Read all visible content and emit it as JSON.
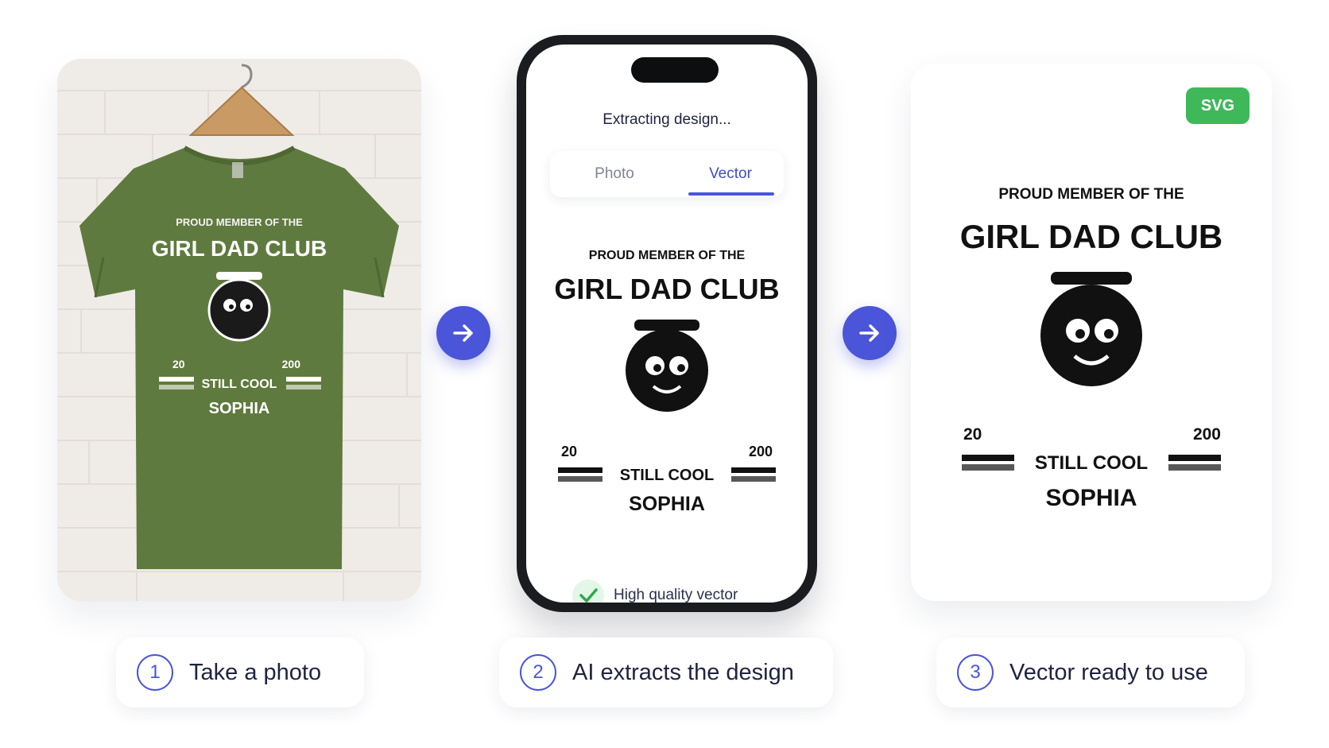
{
  "steps": [
    {
      "number": "1",
      "label": "Take a photo"
    },
    {
      "number": "2",
      "label": "AI extracts the design"
    },
    {
      "number": "3",
      "label": "Vector ready to use"
    }
  ],
  "phone": {
    "status": "Extracting design...",
    "tabs": [
      {
        "label": "Photo"
      },
      {
        "label": "Vector"
      }
    ],
    "active_tab": "Vector",
    "quality": "High quality vector"
  },
  "badge": "SVG",
  "design": {
    "top_arc": "PROUD MEMBER OF THE",
    "main_arc": "GIRL DAD CLUB",
    "year_left": "20",
    "year_right": "200",
    "tagline": "STILL COOL",
    "name": "SOPHIA"
  },
  "colors": {
    "accent": "#4a55d9",
    "badge": "#3fb85a",
    "shirt": "#5f7a3e"
  }
}
